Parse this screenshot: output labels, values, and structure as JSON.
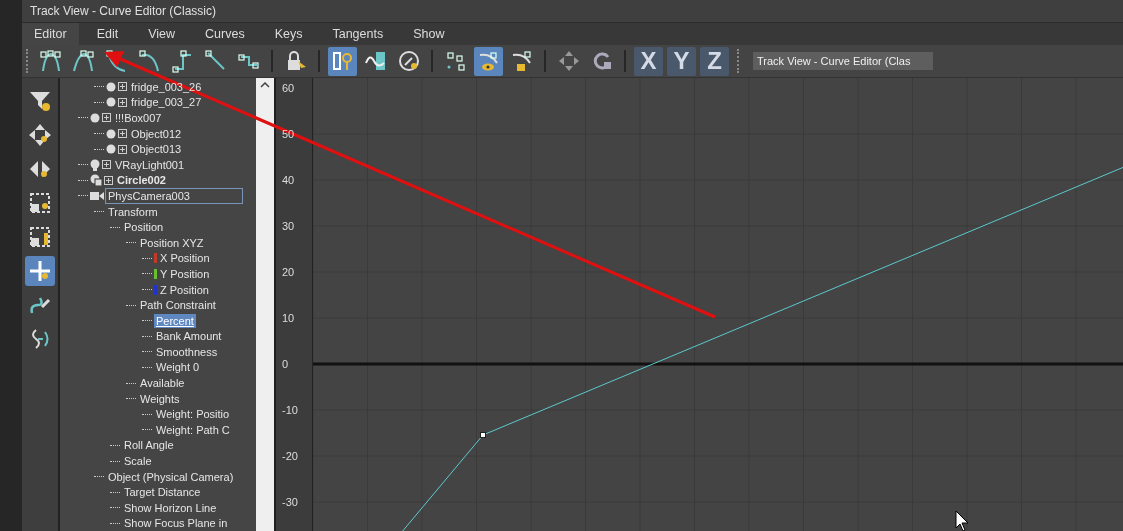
{
  "window": {
    "title": "Track View - Curve Editor (Classic)"
  },
  "menu": [
    {
      "label": "Editor",
      "selected": true
    },
    {
      "label": "Edit",
      "selected": false
    },
    {
      "label": "View",
      "selected": false
    },
    {
      "label": "Curves",
      "selected": false
    },
    {
      "label": "Keys",
      "selected": false
    },
    {
      "label": "Tangents",
      "selected": false
    },
    {
      "label": "Show",
      "selected": false
    }
  ],
  "toolbar": {
    "groups": [
      [
        {
          "selected": false
        },
        {
          "selected": false
        },
        {
          "selected": false
        },
        {
          "selected": false
        },
        {
          "selected": false
        },
        {
          "selected": false
        },
        {
          "selected": false
        }
      ],
      [
        {
          "selected": false
        }
      ],
      [
        {
          "selected": true
        },
        {
          "selected": false
        },
        {
          "selected": false
        }
      ],
      [
        {
          "selected": false
        },
        {
          "selected": true
        },
        {
          "selected": false
        }
      ],
      [
        {
          "selected": false
        },
        {
          "selected": false
        }
      ],
      [
        {
          "label": "X",
          "selected": false
        },
        {
          "label": "Y",
          "selected": false
        },
        {
          "label": "Z",
          "selected": false
        }
      ]
    ],
    "name_field": "Track View - Curve Editor (Clas"
  },
  "side_tools": [
    {
      "selected": false
    },
    {
      "selected": false
    },
    {
      "selected": false
    },
    {
      "selected": false
    },
    {
      "selected": false
    },
    {
      "selected": true
    },
    {
      "selected": false
    },
    {
      "selected": false
    }
  ],
  "tree": [
    {
      "children": [
        {
          "label": "fridge_003_26",
          "kind": "object",
          "expanded": false
        },
        {
          "label": "fridge_003_27",
          "kind": "object",
          "expanded": false
        }
      ]
    },
    {
      "label": "!!!Box007",
      "kind": "object",
      "expanded": false,
      "children": [
        {
          "label": "Object012",
          "kind": "object",
          "expanded": false
        },
        {
          "label": "Object013",
          "kind": "object",
          "expanded": false
        }
      ]
    },
    {
      "label": "VRayLight001",
      "kind": "light",
      "expanded": false
    },
    {
      "label": "Circle002",
      "kind": "shape",
      "expanded": false,
      "bold": true
    },
    {
      "label": "PhysCamera003",
      "kind": "camera",
      "focused": true,
      "children": [
        {
          "label": "Transform",
          "children": [
            {
              "label": "Position",
              "children": [
                {
                  "label": "Position XYZ",
                  "children": [
                    {
                      "label": "X Position",
                      "color": "#c0392b"
                    },
                    {
                      "label": "Y Position",
                      "color": "#6abf2e"
                    },
                    {
                      "label": "Z Position",
                      "color": "#2233cc"
                    }
                  ]
                },
                {
                  "label": "Path Constraint",
                  "children": [
                    {
                      "label": "Percent",
                      "selected": true
                    },
                    {
                      "label": "Bank Amount",
                      "selected": false
                    },
                    {
                      "label": "Smoothness",
                      "selected": false
                    },
                    {
                      "label": "Weight 0",
                      "selected": false
                    }
                  ]
                },
                {
                  "label": "Available"
                },
                {
                  "label": "Weights",
                  "children": [
                    {
                      "label": "Weight: Positio"
                    },
                    {
                      "label": "Weight: Path C"
                    }
                  ]
                }
              ]
            },
            {
              "label": "Roll Angle"
            },
            {
              "label": "Scale"
            }
          ]
        },
        {
          "label": "Object (Physical Camera)",
          "children": [
            {
              "label": "Target Distance"
            },
            {
              "label": "Show Horizon Line"
            },
            {
              "label": "Show Focus Plane in"
            }
          ]
        }
      ]
    }
  ],
  "graph": {
    "y_labels": [
      "60",
      "50",
      "40",
      "30",
      "20",
      "10",
      "0",
      "-10",
      "-20",
      "-30"
    ]
  }
}
